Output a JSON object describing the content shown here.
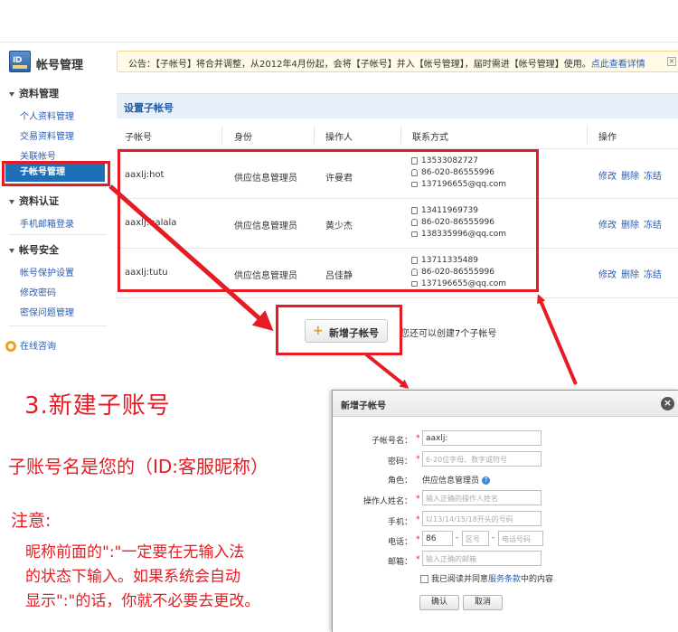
{
  "sidebar": {
    "title": "帐号管理",
    "brand_icon_text": "ID",
    "sections": [
      {
        "label": "资料管理",
        "items": [
          "个人资料管理",
          "交易资料管理",
          "关联帐号",
          "子帐号管理"
        ]
      },
      {
        "label": "资料认证",
        "items": [
          "手机邮箱登录"
        ]
      },
      {
        "label": "帐号安全",
        "items": [
          "帐号保护设置",
          "修改密码",
          "密保问题管理"
        ]
      }
    ],
    "consult": "在线咨询"
  },
  "notice": {
    "text": "公告：【子帐号】将合并调整，从2012年4月份起，会将【子帐号】并入【帐号管理】，届时需进【帐号管理】使用。",
    "link": "点此查看详情"
  },
  "panel": {
    "title": "设置子帐号",
    "columns": [
      "子帐号",
      "身份",
      "操作人",
      "联系方式",
      "操作"
    ],
    "rows": [
      {
        "account": "aaxlj:hot",
        "role": "供应信息管理员",
        "operator": "许曼君",
        "mobile": "13533082727",
        "tel": "86-020-86555996",
        "email": "137196655@qq.com"
      },
      {
        "account": "aaxlj:balala",
        "role": "供应信息管理员",
        "operator": "黄少杰",
        "mobile": "13411969739",
        "tel": "86-020-86555996",
        "email": "138335996@qq.com"
      },
      {
        "account": "aaxlj:tutu",
        "role": "供应信息管理员",
        "operator": "吕佳静",
        "mobile": "13711335489",
        "tel": "86-020-86555996",
        "email": "137196655@qq.com"
      }
    ],
    "ops": [
      "修改",
      "删除",
      "冻结"
    ],
    "add_button": "新增子帐号",
    "add_hint": "您还可以创建7个子帐号"
  },
  "annotation": {
    "step_title": "3.新建子账号",
    "subtitle": "子账号名是您的（ID:客服昵称）",
    "note_label": "注意:",
    "note_lines": [
      "昵称前面的\":\"一定要在无输入法",
      "的状态下输入。如果系统会自动",
      "显示\":\"的话，你就不必要去更改。"
    ]
  },
  "dialog": {
    "title": "新增子帐号",
    "fields": {
      "account_label": "子帐号名：",
      "account_value": "aaxlj:",
      "password_label": "密码：",
      "password_placeholder": "6-20位字母、数字或符号",
      "role_label": "角色：",
      "role_value": "供应信息管理员",
      "operator_label": "操作人姓名：",
      "operator_placeholder": "输入正确的操作人姓名",
      "mobile_label": "手机：",
      "mobile_placeholder": "以13/14/15/18开头的号码",
      "phone_label": "电话：",
      "phone_country": "86",
      "phone_area_placeholder": "区号",
      "phone_number_placeholder": "电话号码",
      "email_label": "邮箱：",
      "email_placeholder": "输入正确的邮箱"
    },
    "agree_prefix": "我已阅读并同意",
    "agree_link": "服务条款",
    "agree_suffix": "中的内容",
    "confirm": "确认",
    "cancel": "取消"
  },
  "colors": {
    "annotation_red": "#e51c23",
    "active_blue": "#1d6fb8",
    "link_blue": "#2a5db0"
  },
  "icons": [
    "id-card-icon",
    "qq-icon",
    "close-icon",
    "plus-icon",
    "help-icon",
    "mobile-icon",
    "phone-icon",
    "mail-icon"
  ]
}
